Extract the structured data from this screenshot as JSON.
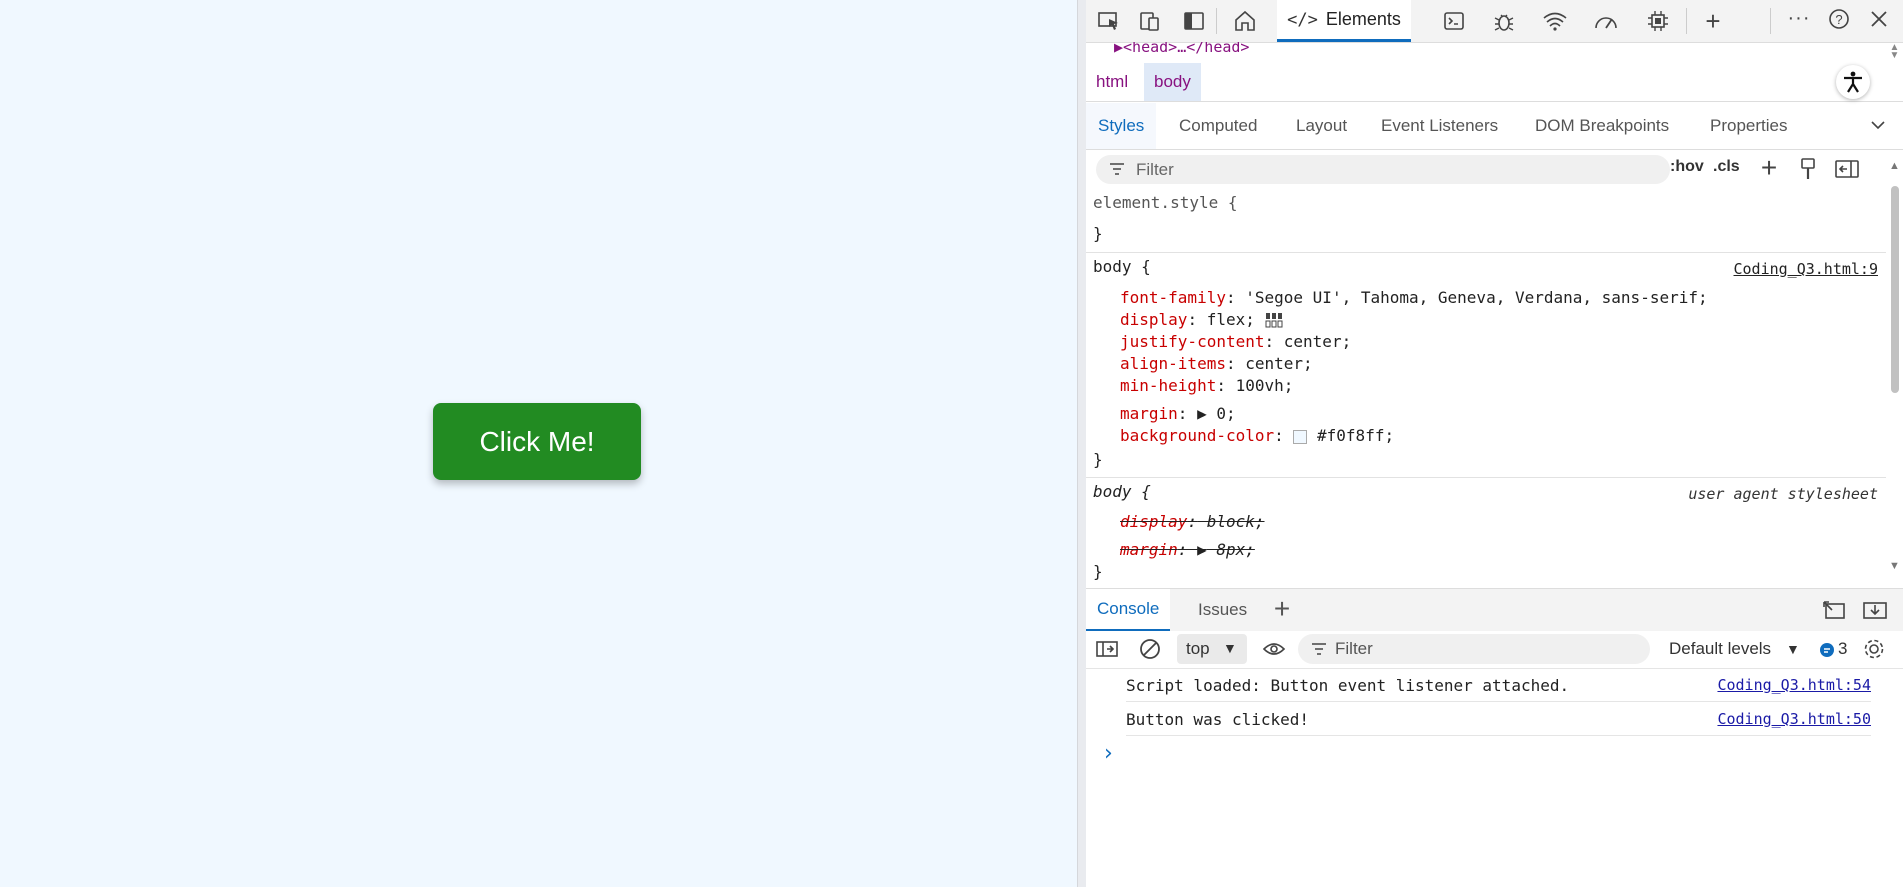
{
  "page": {
    "button_label": "Click Me!",
    "background_color": "#f0f8ff",
    "button_color": "#228b22"
  },
  "devtools": {
    "toolbar": {
      "active_tab": "Elements",
      "icons": [
        "inspect-icon",
        "device-emulation-icon",
        "dock-icon",
        "home-icon",
        "elements-icon",
        "console-icon",
        "bug-icon",
        "network-icon",
        "performance-icon",
        "memory-icon",
        "add-tab-icon",
        "more-icon",
        "help-icon",
        "close-icon"
      ]
    },
    "dom_strip": "▶<head>…</head>",
    "breadcrumb": [
      "html",
      "body"
    ],
    "style_tabs": [
      "Styles",
      "Computed",
      "Layout",
      "Event Listeners",
      "DOM Breakpoints",
      "Properties"
    ],
    "styles_filter": {
      "placeholder": "Filter",
      "hov": ":hov",
      "cls": ".cls"
    },
    "rules": {
      "element_style": {
        "selector": "element.style {",
        "close": "}"
      },
      "body_author": {
        "selector": "body {",
        "source": "Coding_Q3.html:9",
        "declarations": [
          {
            "prop": "font-family",
            "value": " 'Segoe UI', Tahoma, Geneva, Verdana, sans-serif;"
          },
          {
            "prop": "display",
            "value": " flex;"
          },
          {
            "prop": "justify-content",
            "value": " center;"
          },
          {
            "prop": "align-items",
            "value": " center;"
          },
          {
            "prop": "min-height",
            "value": " 100vh;"
          },
          {
            "prop": "margin",
            "value": " 0;"
          },
          {
            "prop": "background-color",
            "value": " #f0f8ff;"
          }
        ],
        "close": "}"
      },
      "body_ua": {
        "selector": "body {",
        "source": "user agent stylesheet",
        "declarations": [
          {
            "prop": "display",
            "value": " block;"
          },
          {
            "prop": "margin",
            "value": " 8px;"
          }
        ],
        "close": "}"
      }
    },
    "console": {
      "tabs": [
        "Console",
        "Issues"
      ],
      "context": "top",
      "filter_placeholder": "Filter",
      "levels": "Default levels",
      "issue_count": "3",
      "messages": [
        {
          "text": "Script loaded: Button event listener attached.",
          "source": "Coding_Q3.html:54"
        },
        {
          "text": "Button was clicked!",
          "source": "Coding_Q3.html:50"
        }
      ],
      "prompt": "›"
    }
  }
}
